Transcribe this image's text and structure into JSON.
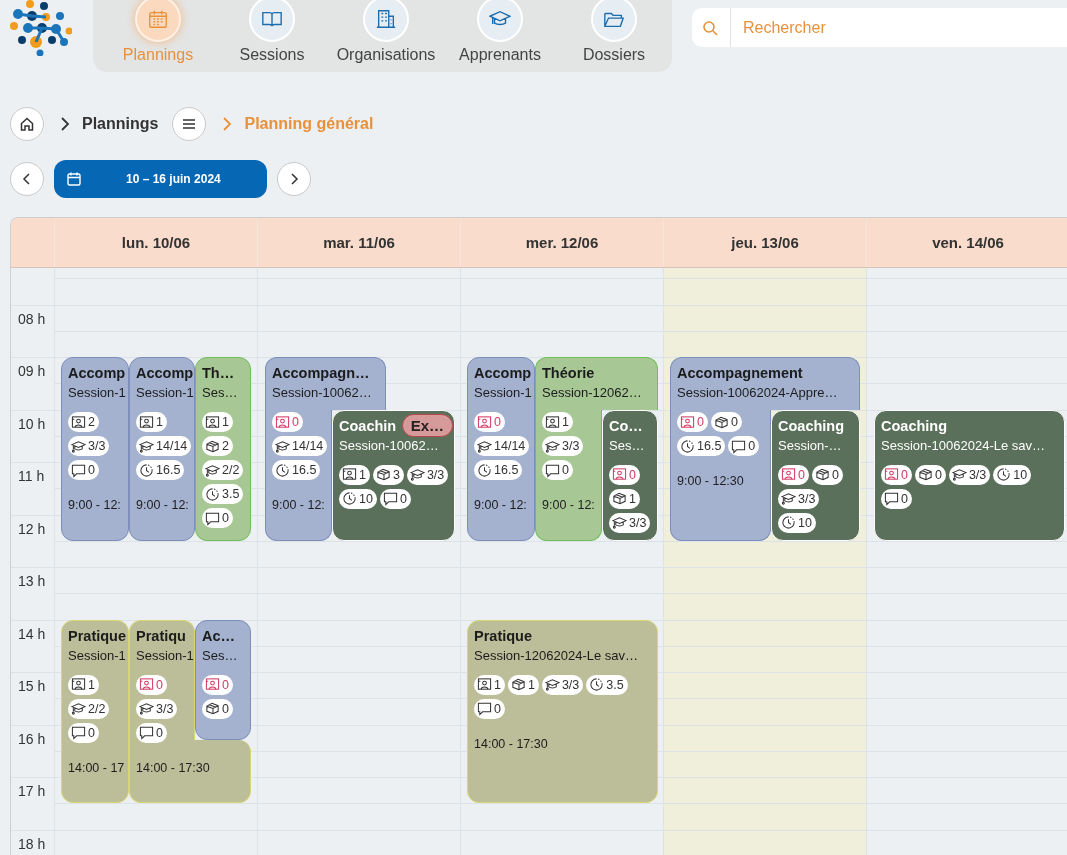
{
  "nav": [
    {
      "label": "Plannings",
      "kind": "calendar",
      "selected": true
    },
    {
      "label": "Sessions",
      "kind": "book",
      "selected": false
    },
    {
      "label": "Organisations",
      "kind": "building",
      "selected": false
    },
    {
      "label": "Apprenants",
      "kind": "cap",
      "selected": false
    },
    {
      "label": "Dossiers",
      "kind": "folder",
      "selected": false
    }
  ],
  "search": {
    "placeholder": "Rechercher"
  },
  "breadcrumb": {
    "root": "Plannings",
    "current": "Planning général"
  },
  "period": "10 – 16 juin 2024",
  "time_labels": [
    "08 h",
    "09 h",
    "10 h",
    "11 h",
    "12 h",
    "13 h",
    "14 h",
    "15 h",
    "16 h",
    "17 h",
    "18 h"
  ],
  "days": [
    {
      "label": "lun. 10/06",
      "today": false,
      "events": [
        {
          "kind": "accompagnement",
          "title": "Accomp",
          "session": "Session-1",
          "chips": [
            {
              "kind": "room",
              "value": "2",
              "alert": false
            },
            {
              "kind": "cap",
              "value": "3/3",
              "alert": false
            },
            {
              "kind": "comment",
              "value": "0",
              "alert": false
            }
          ],
          "time": "9:00 - 12:"
        },
        {
          "kind": "accompagnement",
          "title": "Accomp",
          "session": "Session-1",
          "chips": [
            {
              "kind": "room",
              "value": "1",
              "alert": false
            },
            {
              "kind": "cap",
              "value": "14/14",
              "alert": false
            },
            {
              "kind": "clock",
              "value": "16.5",
              "alert": false
            }
          ],
          "time": "9:00 - 12:"
        },
        {
          "kind": "theorie",
          "title": "Th…",
          "session": "Ses…",
          "chips": [
            {
              "kind": "room",
              "value": "1",
              "alert": false
            },
            {
              "kind": "box",
              "value": "2",
              "alert": false
            },
            {
              "kind": "cap",
              "value": "2/2",
              "alert": false
            },
            {
              "kind": "clock",
              "value": "3.5",
              "alert": false
            },
            {
              "kind": "comment",
              "value": "0",
              "alert": false
            }
          ]
        },
        {
          "kind": "pratique",
          "title": "Pratique",
          "session": "Session-1",
          "chips": [
            {
              "kind": "room",
              "value": "1",
              "alert": false
            },
            {
              "kind": "cap",
              "value": "2/2",
              "alert": false
            },
            {
              "kind": "comment",
              "value": "0",
              "alert": false
            }
          ],
          "time": "14:00 - 17"
        },
        {
          "kind": "pratique",
          "title": "Pratiqu",
          "session": "Session-1",
          "chips": [
            {
              "kind": "room",
              "value": "0",
              "alert": true
            },
            {
              "kind": "cap",
              "value": "3/3",
              "alert": false
            },
            {
              "kind": "comment",
              "value": "0",
              "alert": false
            }
          ],
          "time": "14:00 - 17:30"
        },
        {
          "kind": "accompagnement",
          "title": "Ac…",
          "session": "Ses…",
          "chips": [
            {
              "kind": "room",
              "value": "0",
              "alert": true
            },
            {
              "kind": "box",
              "value": "0",
              "alert": false
            }
          ]
        }
      ]
    },
    {
      "label": "mar. 11/06",
      "today": false,
      "events": [
        {
          "kind": "accompagnement",
          "title": "Accompagn…",
          "session": "Session-10062…",
          "chips": [
            {
              "kind": "room",
              "value": "0",
              "alert": true
            },
            {
              "kind": "cap",
              "value": "14/14",
              "alert": false
            },
            {
              "kind": "clock",
              "value": "16.5",
              "alert": false
            }
          ],
          "time": "9:00 - 12:"
        },
        {
          "kind": "coaching",
          "title": "Coachin",
          "badge": "Ex…",
          "session": "Session-10062…",
          "chips": [
            {
              "kind": "room",
              "value": "1",
              "alert": false
            },
            {
              "kind": "box",
              "value": "3",
              "alert": false
            },
            {
              "kind": "cap",
              "value": "3/3",
              "alert": false
            },
            {
              "kind": "clock",
              "value": "10",
              "alert": false
            },
            {
              "kind": "comment",
              "value": "0",
              "alert": false
            }
          ]
        }
      ]
    },
    {
      "label": "mer. 12/06",
      "today": false,
      "events": [
        {
          "kind": "accompagnement",
          "title": "Accomp",
          "session": "Session-1",
          "chips": [
            {
              "kind": "room",
              "value": "0",
              "alert": true
            },
            {
              "kind": "cap",
              "value": "14/14",
              "alert": false
            },
            {
              "kind": "clock",
              "value": "16.5",
              "alert": false
            }
          ],
          "time": "9:00 - 12:"
        },
        {
          "kind": "theorie",
          "title": "Théorie",
          "session": "Session-12062…",
          "chips": [
            {
              "kind": "room",
              "value": "1",
              "alert": false
            },
            {
              "kind": "cap",
              "value": "3/3",
              "alert": false
            },
            {
              "kind": "comment",
              "value": "0",
              "alert": false
            }
          ],
          "time": "9:00 - 12:"
        },
        {
          "kind": "coaching",
          "title": "Co…",
          "session": "Ses…",
          "chips": [
            {
              "kind": "room",
              "value": "0",
              "alert": true
            },
            {
              "kind": "box",
              "value": "1",
              "alert": false
            },
            {
              "kind": "cap",
              "value": "3/3",
              "alert": false
            }
          ]
        },
        {
          "kind": "pratique",
          "title": "Pratique",
          "session": "Session-12062024-Le sav…",
          "chips": [
            {
              "kind": "room",
              "value": "1",
              "alert": false
            },
            {
              "kind": "box",
              "value": "1",
              "alert": false
            },
            {
              "kind": "cap",
              "value": "3/3",
              "alert": false
            },
            {
              "kind": "clock",
              "value": "3.5",
              "alert": false
            },
            {
              "kind": "comment",
              "value": "0",
              "alert": false
            }
          ],
          "time": "14:00 - 17:30"
        }
      ]
    },
    {
      "label": "jeu. 13/06",
      "today": true,
      "events": [
        {
          "kind": "accompagnement",
          "title": "Accompagnement",
          "session": "Session-10062024-Appre…",
          "chips": [
            {
              "kind": "room",
              "value": "0",
              "alert": true
            },
            {
              "kind": "box",
              "value": "0",
              "alert": false
            },
            {
              "kind": "clock",
              "value": "16.5",
              "alert": false
            },
            {
              "kind": "comment",
              "value": "0",
              "alert": false
            }
          ],
          "time": "9:00 - 12:30"
        },
        {
          "kind": "coaching",
          "title": "Coaching",
          "session": "Session-…",
          "chips": [
            {
              "kind": "room",
              "value": "0",
              "alert": true
            },
            {
              "kind": "box",
              "value": "0",
              "alert": false
            },
            {
              "kind": "cap",
              "value": "3/3",
              "alert": false
            },
            {
              "kind": "clock",
              "value": "10",
              "alert": false
            }
          ]
        }
      ]
    },
    {
      "label": "ven. 14/06",
      "today": false,
      "events": [
        {
          "kind": "coaching",
          "title": "Coaching",
          "session": "Session-10062024-Le sav…",
          "chips": [
            {
              "kind": "room",
              "value": "0",
              "alert": true
            },
            {
              "kind": "box",
              "value": "0",
              "alert": false
            },
            {
              "kind": "cap",
              "value": "3/3",
              "alert": false
            },
            {
              "kind": "clock",
              "value": "10",
              "alert": false
            },
            {
              "kind": "comment",
              "value": "0",
              "alert": false
            }
          ]
        }
      ]
    }
  ]
}
